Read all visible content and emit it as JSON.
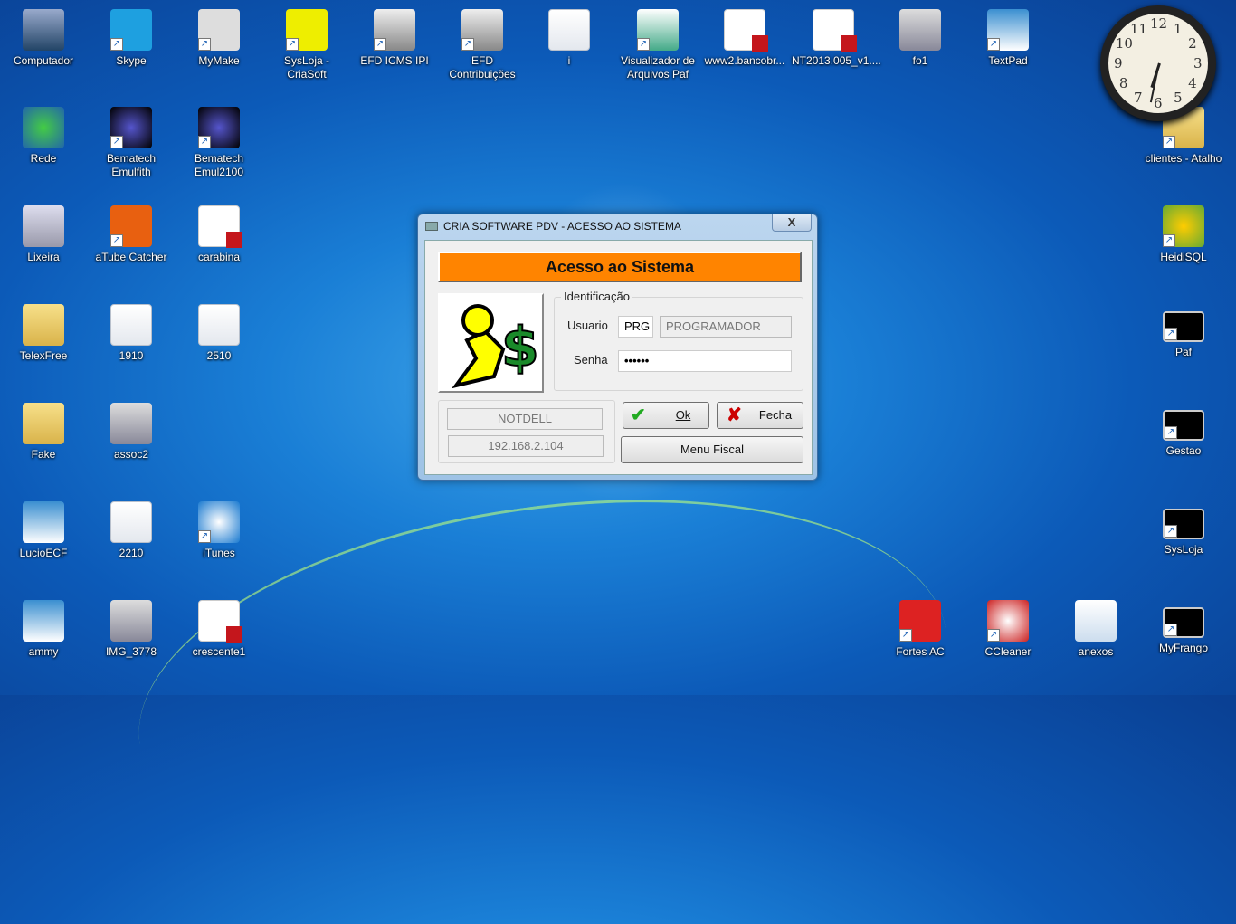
{
  "desktop": {
    "icons": [
      {
        "label": "Computador",
        "type": "computer",
        "shortcut": false
      },
      {
        "label": "Skype",
        "type": "skype",
        "shortcut": true
      },
      {
        "label": "MyMake",
        "type": "app",
        "shortcut": true
      },
      {
        "label": "SysLoja - CriaSoft",
        "type": "criasoft",
        "shortcut": true
      },
      {
        "label": "EFD ICMS IPI",
        "type": "sped",
        "shortcut": true
      },
      {
        "label": "EFD Contribuições",
        "type": "sped",
        "shortcut": true
      },
      {
        "label": "i",
        "type": "doc",
        "shortcut": false
      },
      {
        "label": "Visualizador de Arquivos Paf",
        "type": "acbr",
        "shortcut": true
      },
      {
        "label": "www2.bancobr...",
        "type": "pdf",
        "shortcut": false
      },
      {
        "label": "NT2013.005_v1....",
        "type": "pdf",
        "shortcut": false
      },
      {
        "label": "fo1",
        "type": "image",
        "shortcut": false
      },
      {
        "label": "TextPad",
        "type": "textpad",
        "shortcut": true
      },
      {
        "label": "Rede",
        "type": "network",
        "shortcut": false
      },
      {
        "label": "Bematech Emulfith",
        "type": "bematech",
        "shortcut": true
      },
      {
        "label": "Bematech Emul2100",
        "type": "bematech",
        "shortcut": true
      },
      {
        "label": "Lixeira",
        "type": "recycle",
        "shortcut": false
      },
      {
        "label": "aTube Catcher",
        "type": "atube",
        "shortcut": true
      },
      {
        "label": "carabina",
        "type": "pdf",
        "shortcut": false
      },
      {
        "label": "TelexFree",
        "type": "folder",
        "shortcut": false
      },
      {
        "label": "1910",
        "type": "doc",
        "shortcut": false
      },
      {
        "label": "2510",
        "type": "doc",
        "shortcut": false
      },
      {
        "label": "Fake",
        "type": "folder",
        "shortcut": false
      },
      {
        "label": "assoc2",
        "type": "image",
        "shortcut": false
      },
      {
        "label": "LucioECF",
        "type": "textpad",
        "shortcut": false
      },
      {
        "label": "2210",
        "type": "doc",
        "shortcut": false
      },
      {
        "label": "iTunes",
        "type": "itunes",
        "shortcut": true
      },
      {
        "label": "ammy",
        "type": "textpad",
        "shortcut": false
      },
      {
        "label": "IMG_3778",
        "type": "image",
        "shortcut": false
      },
      {
        "label": "crescente1",
        "type": "pdf",
        "shortcut": false
      },
      {
        "label": "clientes - Atalho",
        "type": "folder",
        "shortcut": true
      },
      {
        "label": "HeidiSQL",
        "type": "heidi",
        "shortcut": true
      },
      {
        "label": "Paf",
        "type": "cmd",
        "shortcut": true
      },
      {
        "label": "Gestao",
        "type": "cmd",
        "shortcut": true
      },
      {
        "label": "SysLoja",
        "type": "cmd",
        "shortcut": true
      },
      {
        "label": "MyFrango",
        "type": "cmd",
        "shortcut": true
      },
      {
        "label": "Fortes AC",
        "type": "fortes",
        "shortcut": true
      },
      {
        "label": "CCleaner",
        "type": "ccleaner",
        "shortcut": true
      },
      {
        "label": "anexos",
        "type": "word",
        "shortcut": false
      }
    ]
  },
  "clock": {
    "numbers": [
      "12",
      "1",
      "2",
      "3",
      "4",
      "5",
      "6",
      "7",
      "8",
      "9",
      "10",
      "11"
    ],
    "hour": 6.6,
    "minute": 32
  },
  "dialog": {
    "title": "CRIA SOFTWARE PDV - ACESSO AO SISTEMA",
    "close": "X",
    "banner": "Acesso ao Sistema",
    "group_label": "Identificação",
    "user_label": "Usuario",
    "user_code": "PRG",
    "user_name": "PROGRAMADOR",
    "password_label": "Senha",
    "password": "••••••",
    "machine": "NOTDELL",
    "ip": "192.168.2.104",
    "ok": "Ok",
    "fecha": "Fecha",
    "menu_fiscal": "Menu Fiscal"
  }
}
